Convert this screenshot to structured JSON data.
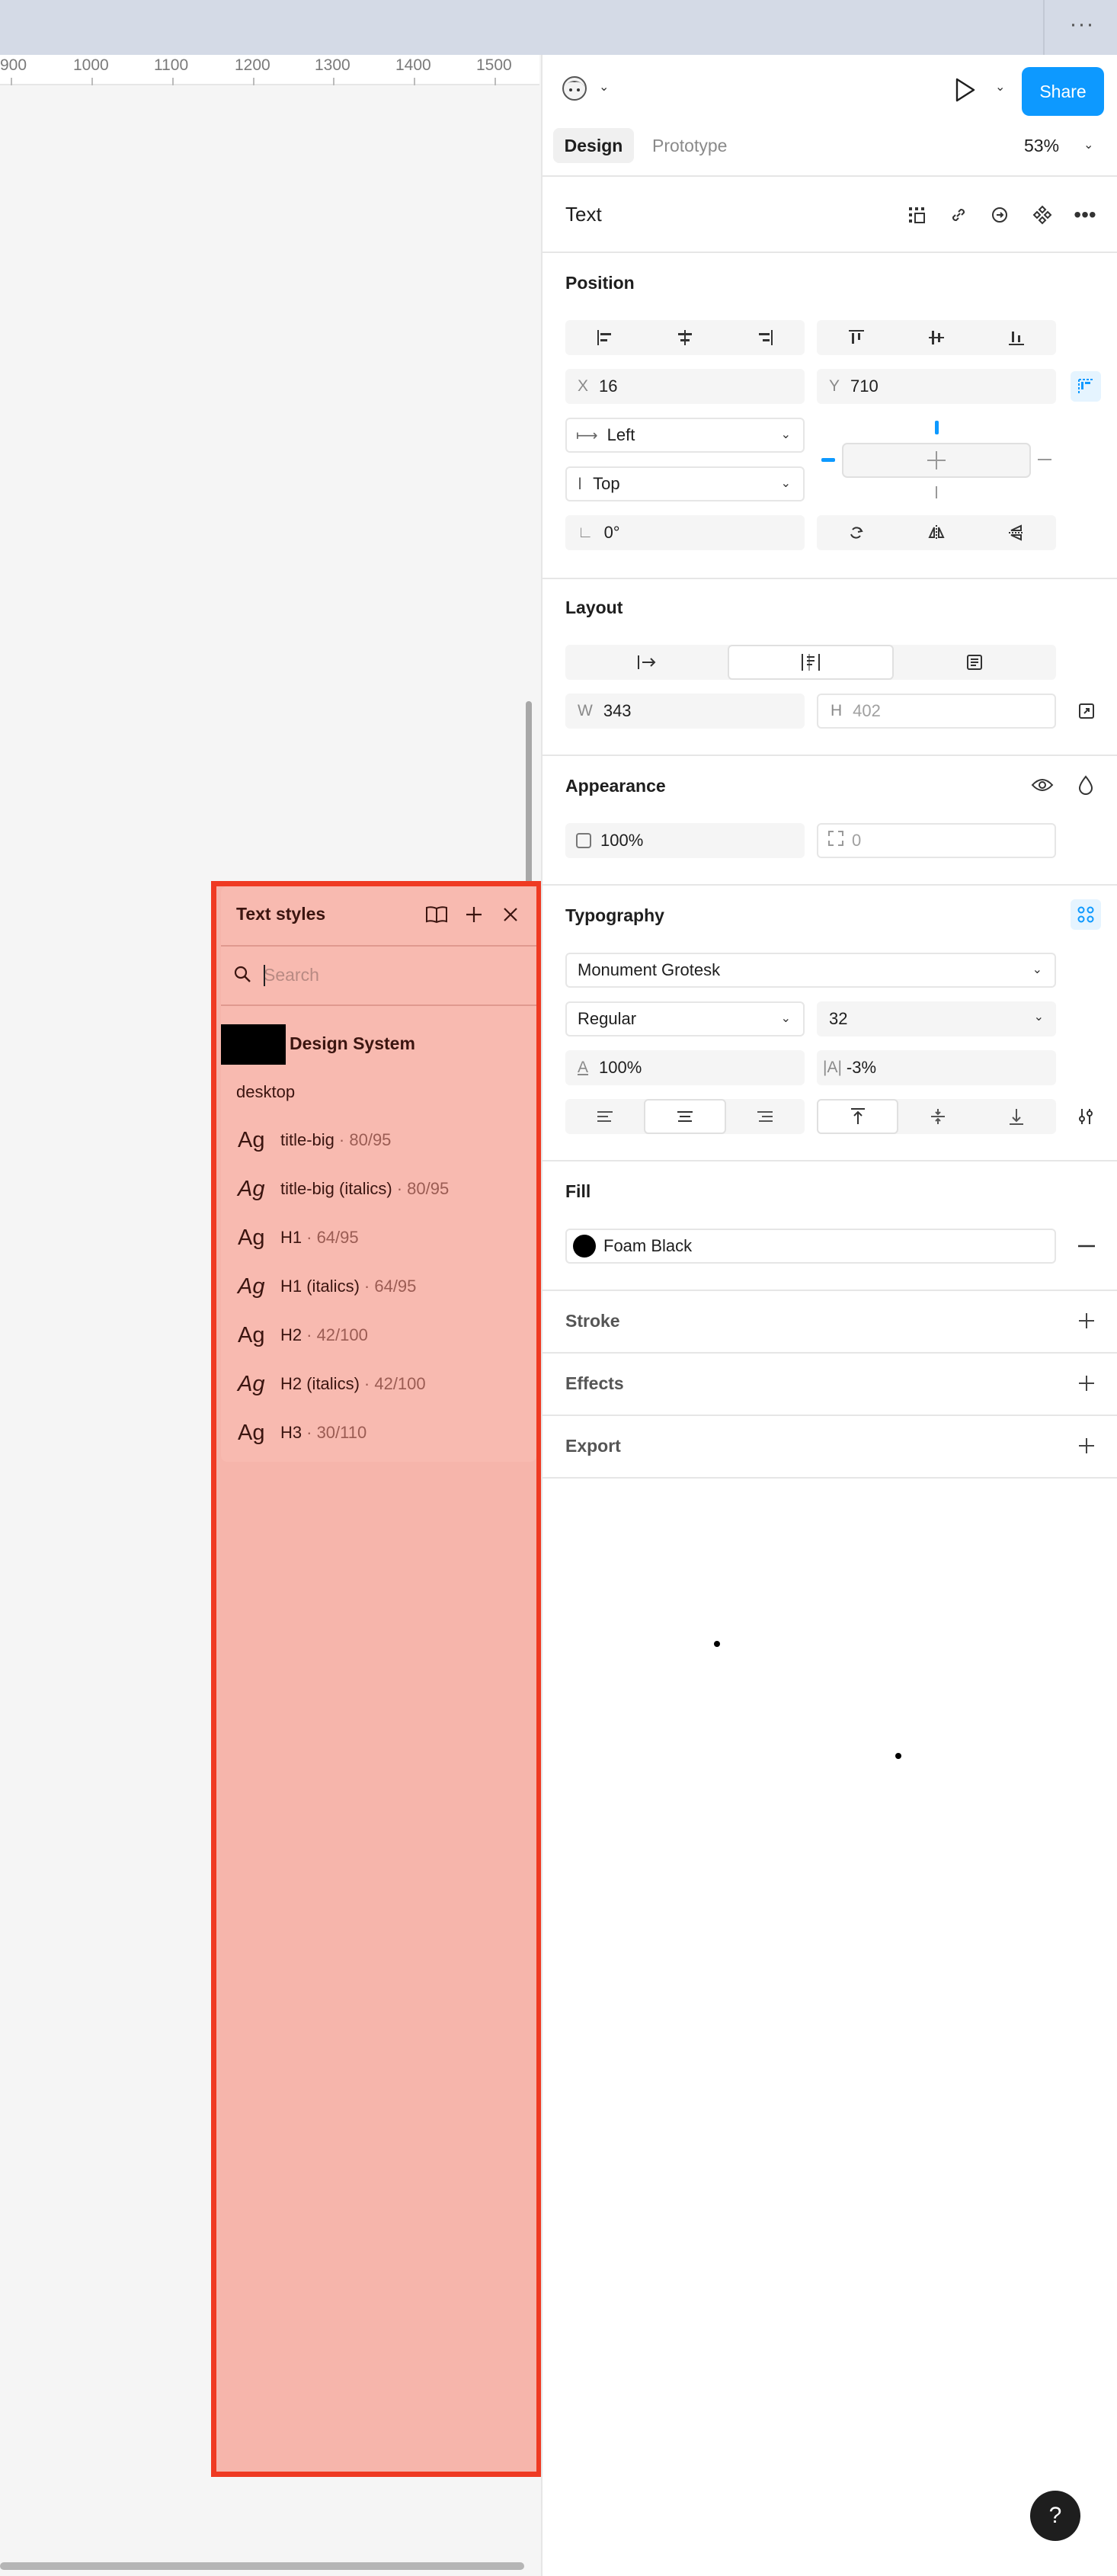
{
  "ruler": {
    "ticks": [
      "900",
      "1000",
      "1100",
      "1200",
      "1300",
      "1400",
      "1500"
    ]
  },
  "header": {
    "share_label": "Share",
    "tabs": [
      {
        "label": "Design"
      },
      {
        "label": "Prototype"
      }
    ],
    "zoom": "53%"
  },
  "layer": {
    "title": "Text"
  },
  "position": {
    "title": "Position",
    "x_label": "X",
    "x_value": "16",
    "y_label": "Y",
    "y_value": "710",
    "h_constraint": "Left",
    "v_constraint": "Top",
    "rotation": "0°"
  },
  "layout": {
    "title": "Layout",
    "w_label": "W",
    "w_value": "343",
    "h_label": "H",
    "h_value": "402"
  },
  "appearance": {
    "title": "Appearance",
    "opacity": "100%",
    "radius": "0"
  },
  "typography": {
    "title": "Typography",
    "font_family": "Monument Grotesk",
    "font_weight": "Regular",
    "font_size": "32",
    "line_height": "100%",
    "letter_spacing": "-3%"
  },
  "fill": {
    "title": "Fill",
    "color_name": "Foam Black",
    "color": "#000000"
  },
  "sections": {
    "stroke": "Stroke",
    "effects": "Effects",
    "export": "Export"
  },
  "text_styles": {
    "title": "Text styles",
    "search_placeholder": "Search",
    "library_name": "Design System",
    "group": "desktop",
    "items": [
      {
        "ag": "Ag",
        "italic": false,
        "name": "title-big",
        "meta": "· 80/95"
      },
      {
        "ag": "Ag",
        "italic": true,
        "name": "title-big (italics)",
        "meta": "· 80/95"
      },
      {
        "ag": "Ag",
        "italic": false,
        "name": "H1",
        "meta": "· 64/95"
      },
      {
        "ag": "Ag",
        "italic": true,
        "name": "H1 (italics)",
        "meta": "· 64/95"
      },
      {
        "ag": "Ag",
        "italic": false,
        "name": "H2",
        "meta": "· 42/100"
      },
      {
        "ag": "Ag",
        "italic": true,
        "name": "H2 (italics)",
        "meta": "· 42/100"
      },
      {
        "ag": "Ag",
        "italic": false,
        "name": "H3",
        "meta": "· 30/110"
      }
    ]
  },
  "help": {
    "label": "?"
  },
  "colors": {
    "accent": "#0d99ff",
    "highlight_border": "#ef3a22",
    "highlight_fill": "#f79d8f"
  }
}
